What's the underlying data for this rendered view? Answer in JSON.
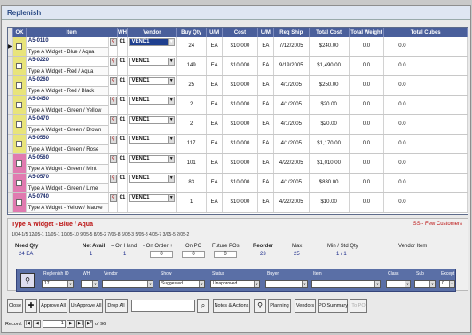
{
  "window": {
    "title": "Replenish"
  },
  "grid": {
    "headers": [
      "OK",
      "Item",
      "WH",
      "Vendor",
      "Buy Qty",
      "U/M",
      "Cost",
      "U/M",
      "Req Ship",
      "Total Cost",
      "Total Weight",
      "Total Cubes"
    ],
    "rows": [
      {
        "item": "A5-0110",
        "desc": "Type A Widget - Blue / Aqua",
        "wh": "01",
        "vendor": "VEND1",
        "buy_qty": "24",
        "um": "EA",
        "cost": "$10.000",
        "um2": "EA",
        "req_ship": "7/12/2005",
        "total_cost": "$240.00",
        "total_weight": "0.0",
        "total_cubes": "0.0",
        "color": "#e8e47a",
        "current": true
      },
      {
        "item": "A5-0220",
        "desc": "Type A Widget - Red / Aqua",
        "wh": "01",
        "vendor": "VEND1",
        "buy_qty": "149",
        "um": "EA",
        "cost": "$10.000",
        "um2": "EA",
        "req_ship": "9/19/2005",
        "total_cost": "$1,490.00",
        "total_weight": "0.0",
        "total_cubes": "0.0",
        "color": "#e8e47a",
        "current": false
      },
      {
        "item": "A5-0260",
        "desc": "Type A Widget - Red / Black",
        "wh": "01",
        "vendor": "VEND1",
        "buy_qty": "25",
        "um": "EA",
        "cost": "$10.000",
        "um2": "EA",
        "req_ship": "4/1/2005",
        "total_cost": "$250.00",
        "total_weight": "0.0",
        "total_cubes": "0.0",
        "color": "#e8e47a",
        "current": false
      },
      {
        "item": "A5-0450",
        "desc": "Type A Widget - Green / Yellow",
        "wh": "01",
        "vendor": "VEND1",
        "buy_qty": "2",
        "um": "EA",
        "cost": "$10.000",
        "um2": "EA",
        "req_ship": "4/1/2005",
        "total_cost": "$20.00",
        "total_weight": "0.0",
        "total_cubes": "0.0",
        "color": "#e8e47a",
        "current": false
      },
      {
        "item": "A5-0470",
        "desc": "Type A Widget - Green / Brown",
        "wh": "01",
        "vendor": "VEND1",
        "buy_qty": "2",
        "um": "EA",
        "cost": "$10.000",
        "um2": "EA",
        "req_ship": "4/1/2005",
        "total_cost": "$20.00",
        "total_weight": "0.0",
        "total_cubes": "0.0",
        "color": "#e8e47a",
        "current": false
      },
      {
        "item": "A5-0550",
        "desc": "Type A Widget - Green / Rose",
        "wh": "01",
        "vendor": "VEND1",
        "buy_qty": "117",
        "um": "EA",
        "cost": "$10.000",
        "um2": "EA",
        "req_ship": "4/1/2005",
        "total_cost": "$1,170.00",
        "total_weight": "0.0",
        "total_cubes": "0.0",
        "color": "#e8e47a",
        "current": false
      },
      {
        "item": "A5-0560",
        "desc": "Type A Widget - Green / Mint",
        "wh": "01",
        "vendor": "VEND1",
        "buy_qty": "101",
        "um": "EA",
        "cost": "$10.000",
        "um2": "EA",
        "req_ship": "4/22/2005",
        "total_cost": "$1,010.00",
        "total_weight": "0.0",
        "total_cubes": "0.0",
        "color": "#e07ab0",
        "current": false
      },
      {
        "item": "A5-0570",
        "desc": "Type A Widget - Green / Lime",
        "wh": "01",
        "vendor": "VEND1",
        "buy_qty": "83",
        "um": "EA",
        "cost": "$10.000",
        "um2": "EA",
        "req_ship": "4/1/2005",
        "total_cost": "$830.00",
        "total_weight": "0.0",
        "total_cubes": "0.0",
        "color": "#e07ab0",
        "current": false
      },
      {
        "item": "A5-0740",
        "desc": "Type A Widget - Yellow / Mauve",
        "wh": "01",
        "vendor": "VEND1",
        "buy_qty": "1",
        "um": "EA",
        "cost": "$10.000",
        "um2": "EA",
        "req_ship": "4/22/2005",
        "total_cost": "$10.00",
        "total_weight": "0.0",
        "total_cubes": "0.0",
        "color": "#e07ab0",
        "current": false
      }
    ]
  },
  "detail": {
    "title": "Type A Widget - Blue / Aqua",
    "ss_note": "SS - Few Customers",
    "history": "1/04-1/5  12/05-1  11/05-1  10/05-10  9/05-5  8/05-2  7/05-8  6/05-3  5/05-8  4/05-7  3/05-5  2/05-2",
    "need_qty_label": "Need Qty",
    "need_qty_value": "24 EA",
    "net_avail_label": "Net Avail",
    "net_eq": "= On Hand",
    "on_order_label": "- On Order +",
    "on_po_label": "On PO",
    "future_pos_label": "Future POs",
    "net_avail_value": "1",
    "on_hand_value": "1",
    "on_order_value": "0",
    "on_po_value": "0",
    "future_pos_value": "0",
    "reorder_label": "Reorder",
    "reorder_value": "23",
    "max_label": "Max",
    "max_value": "25",
    "min_std_label": "Min / Std Qty",
    "min_std_value": "1 / 1",
    "vendor_item_label": "Vendor Item"
  },
  "filters": {
    "labels": [
      "Replenish ID",
      "WH",
      "Vendor",
      "Show",
      "Status",
      "Buyer",
      "Item",
      "Class",
      "Sub",
      "Except"
    ],
    "values": [
      "17",
      "",
      "",
      "Suggested",
      "Unapproved",
      "",
      "",
      "",
      "",
      "0"
    ]
  },
  "buttons": {
    "close": "Close",
    "approve_all": "Approve All",
    "unapprove_all": "UnApprove All",
    "drop_all": "Drop All",
    "notes": "Notes & Actions",
    "planning": "Planning",
    "vendors": "Vendors",
    "po_summary": "PO Summary",
    "to_po": "To PO"
  },
  "recnav": {
    "label": "Record:",
    "current": "1",
    "of_label": "of 96"
  }
}
